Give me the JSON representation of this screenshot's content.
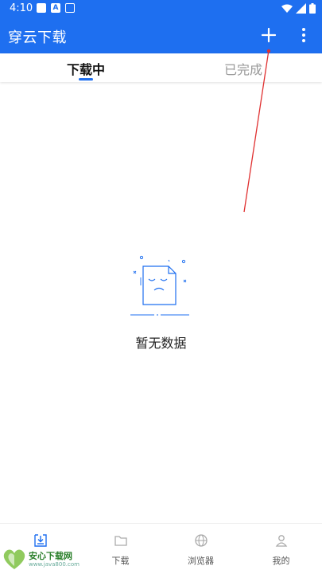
{
  "status_bar": {
    "time": "4:10",
    "letter_icon": "A"
  },
  "app_bar": {
    "title": "穿云下载",
    "add_icon": "plus-icon",
    "more_icon": "more-vert-icon"
  },
  "tabs": [
    {
      "label": "下载中",
      "active": true
    },
    {
      "label": "已完成",
      "active": false
    }
  ],
  "empty_state": {
    "message": "暂无数据",
    "icon": "empty-document-icon"
  },
  "bottom_nav": [
    {
      "label": "",
      "icon": "download-tray-icon",
      "active": true
    },
    {
      "label": "下载",
      "icon": "folder-icon"
    },
    {
      "label": "浏览器",
      "icon": "globe-icon"
    },
    {
      "label": "我的",
      "icon": "person-icon"
    }
  ],
  "watermark": {
    "title": "安心下载网",
    "url": "www.java800.com"
  },
  "colors": {
    "primary": "#1e6ff0",
    "annotation": "#e03030"
  }
}
